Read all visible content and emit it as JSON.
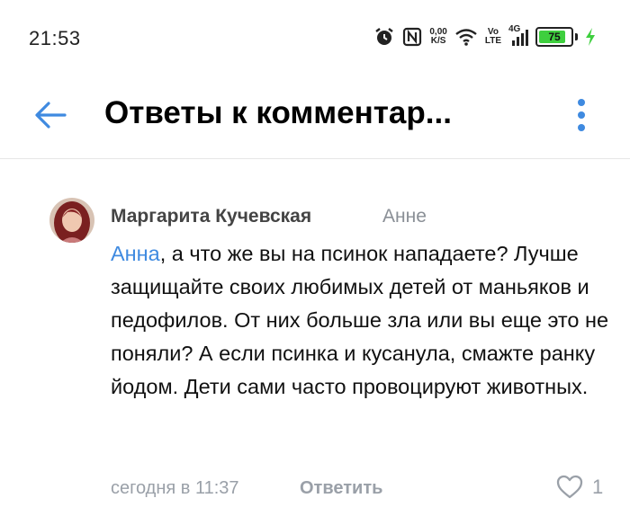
{
  "status_bar": {
    "time": "21:53",
    "net_speed_value": "0,00",
    "net_speed_unit": "K/S",
    "volte_top": "Vo",
    "volte_bottom": "LTE",
    "network": "4G",
    "battery_level": "75",
    "icons": [
      "alarm-icon",
      "nfc-icon",
      "wifi-icon",
      "signal-icon",
      "battery-icon",
      "charging-icon"
    ]
  },
  "header": {
    "title": "Ответы к комментар..."
  },
  "comment": {
    "author": "Маргарита Кучевская",
    "reply_to": "Анне",
    "mention": "Анна",
    "text": ", а что же вы на псинок нападаете? Лучше защищайте своих любимых детей от маньяков и педофилов. От них больше зла или вы еще это не поняли? А если псинка и кусанула, смажте ранку йодом. Дети сами часто провоцируют животных.",
    "timestamp": "сегодня в 11:37",
    "reply_label": "Ответить",
    "likes": "1"
  },
  "colors": {
    "accent": "#3f8ae0",
    "secondary_text": "#9aa0a8",
    "battery_fill": "#3ecf3e"
  }
}
